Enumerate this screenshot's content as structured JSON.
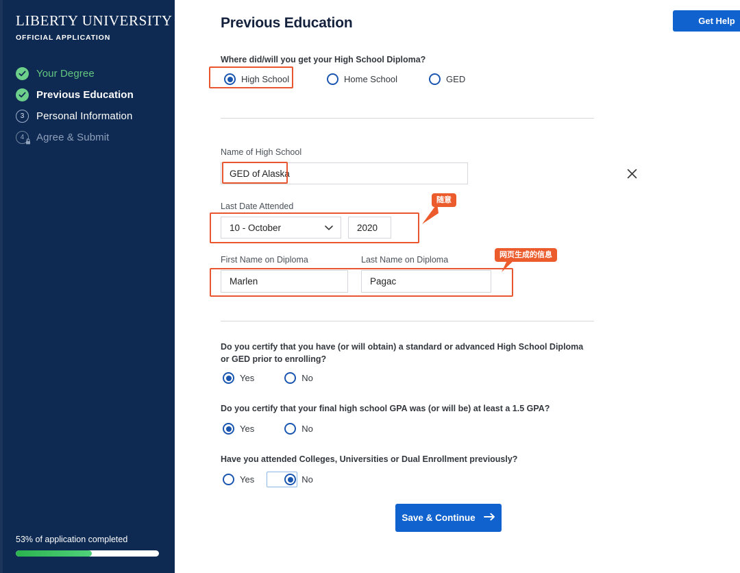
{
  "sidebar": {
    "brand_title": "LIBERTY UNIVERSITY",
    "brand_subtitle": "OFFICIAL APPLICATION",
    "steps": [
      {
        "label": "Your Degree",
        "state": "completed",
        "icon": "check-icon"
      },
      {
        "label": "Previous Education",
        "state": "active-completed",
        "icon": "check-icon"
      },
      {
        "label": "Personal Information",
        "state": "current",
        "number": "3"
      },
      {
        "label": "Agree & Submit",
        "state": "locked",
        "number": "4",
        "icon": "lock-icon"
      }
    ],
    "progress": {
      "text": "53% of application completed",
      "percent": 53
    }
  },
  "header": {
    "title": "Previous Education",
    "get_help_label": "Get Help"
  },
  "form": {
    "diploma_source": {
      "question": "Where did/will you get your High School Diploma?",
      "options": [
        {
          "label": "High School",
          "selected": true
        },
        {
          "label": "Home School",
          "selected": false
        },
        {
          "label": "GED",
          "selected": false
        }
      ]
    },
    "school_name": {
      "label": "Name of High School",
      "value": "GED of Alaska",
      "clear_icon": "close-icon"
    },
    "last_date_attended": {
      "label": "Last Date Attended",
      "month_value": "10 - October",
      "year_value": "2020"
    },
    "first_name_diploma": {
      "label": "First Name on Diploma",
      "value": "Marlen"
    },
    "last_name_diploma": {
      "label": "Last Name on Diploma",
      "value": "Pagac"
    },
    "certify_diploma": {
      "question": "Do you certify that you have (or will obtain) a standard or advanced High School Diploma or GED prior to enrolling?",
      "options": [
        {
          "label": "Yes",
          "selected": true
        },
        {
          "label": "No",
          "selected": false
        }
      ]
    },
    "certify_gpa": {
      "question": "Do you certify that your final high school GPA was (or will be) at least a 1.5 GPA?",
      "options": [
        {
          "label": "Yes",
          "selected": true
        },
        {
          "label": "No",
          "selected": false
        }
      ]
    },
    "attended_college": {
      "question": "Have you attended Colleges, Universities or Dual Enrollment previously?",
      "options": [
        {
          "label": "Yes",
          "selected": false
        },
        {
          "label": "No",
          "selected": true
        }
      ]
    },
    "submit_label": "Save & Continue",
    "submit_icon": "arrow-right-icon"
  },
  "annotations": [
    {
      "text": "随意"
    },
    {
      "text": "网页生成的信息"
    }
  ],
  "colors": {
    "sidebar_bg": "#0f2a52",
    "accent_blue": "#1062ce",
    "radio_blue": "#1a56b0",
    "highlight_red": "#e8552f",
    "callout_orange": "#ec5b2c",
    "progress_green": "#2bb34f"
  }
}
